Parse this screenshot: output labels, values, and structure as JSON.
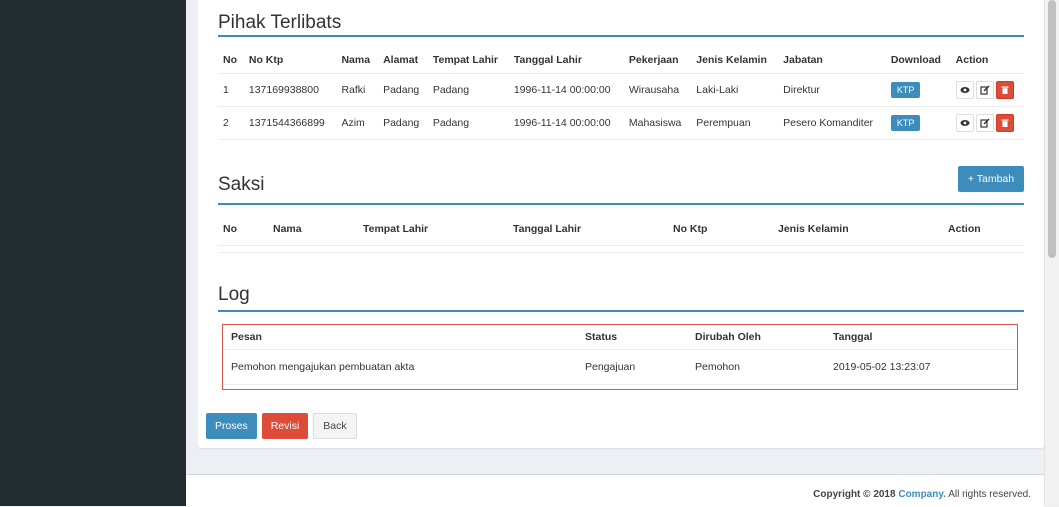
{
  "pihak": {
    "title": "Pihak Terlibats",
    "headers": [
      "No",
      "No Ktp",
      "Nama",
      "Alamat",
      "Tempat Lahir",
      "Tanggal Lahir",
      "Pekerjaan",
      "Jenis Kelamin",
      "Jabatan",
      "Download",
      "Action"
    ],
    "rows": [
      [
        "1",
        "137169938800",
        "Rafki",
        "Padang",
        "Padang",
        "1996-11-14 00:00:00",
        "Wirausaha",
        "Laki-Laki",
        "Direktur"
      ],
      [
        "2",
        "1371544366899",
        "Azim",
        "Padang",
        "Padang",
        "1996-11-14 00:00:00",
        "Mahasiswa",
        "Perempuan",
        "Pesero Komanditer"
      ]
    ],
    "download_label": "KTP"
  },
  "saksi": {
    "title": "Saksi",
    "add_label": "+ Tambah",
    "headers": [
      "No",
      "Nama",
      "Tempat Lahir",
      "Tanggal Lahir",
      "No Ktp",
      "Jenis Kelamin",
      "Action"
    ]
  },
  "log": {
    "title": "Log",
    "headers": [
      "Pesan",
      "Status",
      "Dirubah Oleh",
      "Tanggal"
    ],
    "rows": [
      [
        "Pemohon mengajukan pembuatan akta",
        "Pengajuan",
        "Pemohon",
        "2019-05-02 13:23:07"
      ]
    ]
  },
  "buttons": {
    "proses": "Proses",
    "revisi": "Revisi",
    "back": "Back"
  },
  "footer": {
    "copyright": "Copyright © 2018",
    "company": "Company.",
    "rights": "All rights reserved."
  },
  "icons": {
    "view": "eye-icon",
    "edit": "edit-icon",
    "delete": "trash-icon"
  },
  "colors": {
    "primary": "#3c8dbc",
    "danger": "#dd4b39",
    "sidebar": "#222d32"
  }
}
